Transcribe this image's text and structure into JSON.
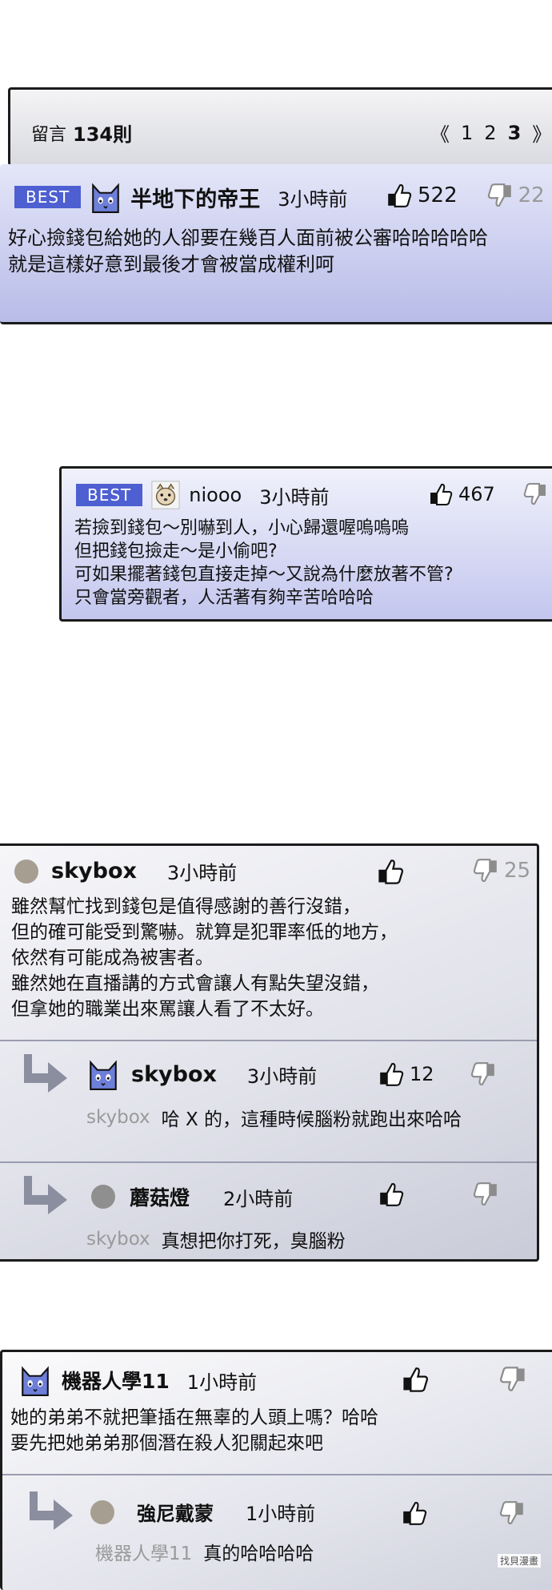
{
  "header": {
    "comments_label": "留言",
    "comments_count": "134則",
    "pager_prev": "《",
    "pages": [
      "1",
      "2",
      "3"
    ],
    "pager_next": "》"
  },
  "comments": [
    {
      "badge": "BEST",
      "author": "半地下的帝王",
      "time": "3小時前",
      "likes": "522",
      "dislikes": "22",
      "text": "好心撿錢包給她的人卻要在幾百人面前被公審哈哈哈哈哈\n就是這樣好意到最後才會被當成權利呵"
    },
    {
      "badge": "BEST",
      "author": "niooo",
      "time": "3小時前",
      "likes": "467",
      "dislikes": "",
      "text": "若撿到錢包～別嚇到人，小心歸還喔嗚嗚嗚\n但把錢包撿走～是小偷吧?\n可如果擺著錢包直接走掉～又說為什麼放著不管?\n只會當旁觀者，人活著有夠辛苦哈哈哈"
    },
    {
      "author": "skybox",
      "time": "3小時前",
      "likes": "",
      "dislikes": "25",
      "text": "雖然幫忙找到錢包是值得感謝的善行沒錯，\n但的確可能受到驚嚇。就算是犯罪率低的地方，\n依然有可能成為被害者。\n雖然她在直播講的方式會讓人有點失望沒錯，\n但拿她的職業出來罵讓人看了不太好。",
      "replies": [
        {
          "author": "skybox",
          "time": "3小時前",
          "likes": "12",
          "reply_to": "skybox",
          "text": "哈 X 的，這種時候腦粉就跑出來哈哈"
        },
        {
          "author": "蘑菇燈",
          "time": "2小時前",
          "likes": "",
          "reply_to": "skybox",
          "text": "真想把你打死，臭腦粉"
        }
      ]
    },
    {
      "author": "機器人學11",
      "time": "1小時前",
      "likes": "",
      "text": "她的弟弟不就把筆插在無辜的人頭上嗎？哈哈\n要先把她弟弟那個潛在殺人犯關起來吧",
      "replies": [
        {
          "author": "強尼戴蒙",
          "time": "1小時前",
          "likes": "",
          "reply_to": "機器人學11",
          "text": "真的哈哈哈哈"
        }
      ]
    }
  ],
  "watermark": "找貝漫畫",
  "colors": {
    "best_badge": "#4d5fd1",
    "card_tint": "#c7caf0",
    "border": "#1b1b1b",
    "muted": "#9a9a9a"
  },
  "icons": [
    "cat-avatar-icon",
    "dog-avatar-icon",
    "round-avatar-icon",
    "thumbs-up-icon",
    "thumbs-down-icon",
    "reply-arrow-icon"
  ]
}
